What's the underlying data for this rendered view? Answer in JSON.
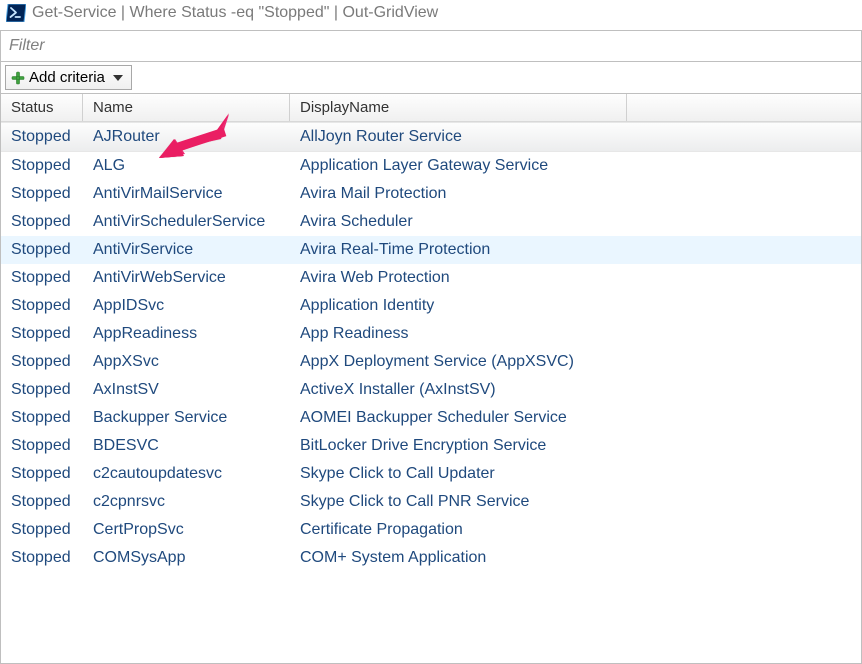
{
  "title": "Get-Service | Where Status -eq \"Stopped\" | Out-GridView",
  "filter": {
    "placeholder": "Filter"
  },
  "add_criteria_label": "Add criteria",
  "columns": {
    "status": "Status",
    "name": "Name",
    "displayname": "DisplayName"
  },
  "rows": [
    {
      "status": "Stopped",
      "name": "AJRouter",
      "displayname": "AllJoyn Router Service",
      "selected": true
    },
    {
      "status": "Stopped",
      "name": "ALG",
      "displayname": "Application Layer Gateway Service"
    },
    {
      "status": "Stopped",
      "name": "AntiVirMailService",
      "displayname": "Avira Mail Protection"
    },
    {
      "status": "Stopped",
      "name": "AntiVirSchedulerService",
      "displayname": "Avira Scheduler"
    },
    {
      "status": "Stopped",
      "name": "AntiVirService",
      "displayname": "Avira Real-Time Protection",
      "highlight": true
    },
    {
      "status": "Stopped",
      "name": "AntiVirWebService",
      "displayname": "Avira Web Protection"
    },
    {
      "status": "Stopped",
      "name": "AppIDSvc",
      "displayname": "Application Identity"
    },
    {
      "status": "Stopped",
      "name": "AppReadiness",
      "displayname": "App Readiness"
    },
    {
      "status": "Stopped",
      "name": "AppXSvc",
      "displayname": "AppX Deployment Service (AppXSVC)"
    },
    {
      "status": "Stopped",
      "name": "AxInstSV",
      "displayname": "ActiveX Installer (AxInstSV)"
    },
    {
      "status": "Stopped",
      "name": "Backupper Service",
      "displayname": "AOMEI Backupper Scheduler Service"
    },
    {
      "status": "Stopped",
      "name": "BDESVC",
      "displayname": "BitLocker Drive Encryption Service"
    },
    {
      "status": "Stopped",
      "name": "c2cautoupdatesvc",
      "displayname": "Skype Click to Call Updater"
    },
    {
      "status": "Stopped",
      "name": "c2cpnrsvc",
      "displayname": "Skype Click to Call PNR Service"
    },
    {
      "status": "Stopped",
      "name": "CertPropSvc",
      "displayname": "Certificate Propagation"
    },
    {
      "status": "Stopped",
      "name": "COMSysApp",
      "displayname": "COM+ System Application"
    }
  ]
}
